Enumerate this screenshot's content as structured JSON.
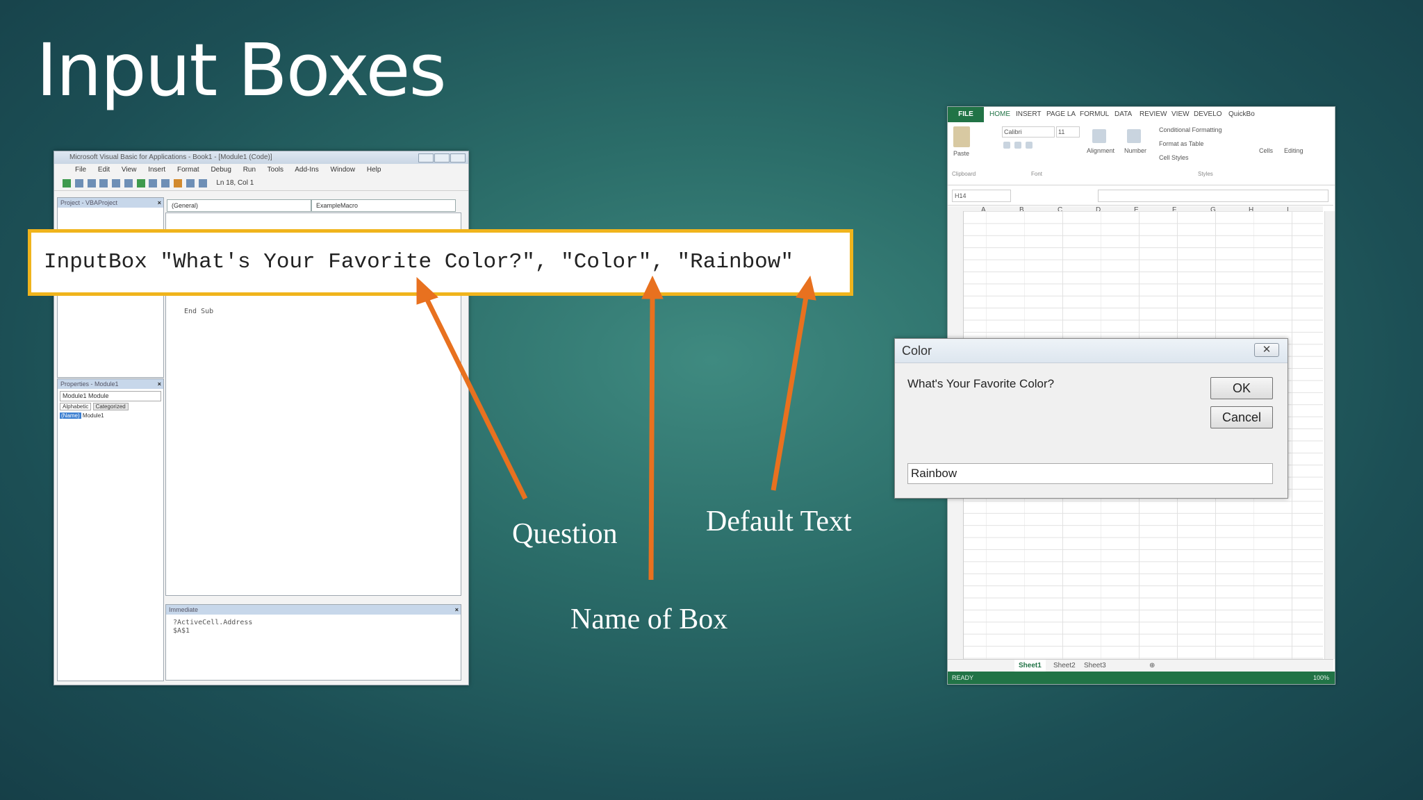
{
  "slide": {
    "title": "Input Boxes"
  },
  "vba": {
    "title": "Microsoft Visual Basic for Applications - Book1 - [Module1 (Code)]",
    "menu": [
      "File",
      "Edit",
      "View",
      "Insert",
      "Format",
      "Debug",
      "Run",
      "Tools",
      "Add-Ins",
      "Window",
      "Help"
    ],
    "position": "Ln 18, Col 1",
    "project_pane_title": "Project - VBAProject",
    "properties_pane_title": "Properties - Module1",
    "properties_object": "Module1 Module",
    "properties_tabs": [
      "Alphabetic",
      "Categorized"
    ],
    "properties_name_key": "(Name)",
    "properties_name_value": "Module1",
    "code_object": "(General)",
    "code_procedure": "ExampleMacro",
    "code_end": "End Sub",
    "immediate_title": "Immediate",
    "immediate_lines": [
      "?ActiveCell.Address",
      "$A$1"
    ]
  },
  "callout": {
    "code": "InputBox \"What's Your Favorite Color?\", \"Color\", \"Rainbow\""
  },
  "labels": {
    "question": "Question",
    "name_of_box": "Name of Box",
    "default_text": "Default Text"
  },
  "colors": {
    "arrow": "#e8711f",
    "callout_border": "#f0b41c",
    "excel_green": "#217346"
  },
  "excel": {
    "tabs": [
      "FILE",
      "HOME",
      "INSERT",
      "PAGE LA",
      "FORMUL",
      "DATA",
      "REVIEW",
      "VIEW",
      "DEVELO",
      "QuickBo"
    ],
    "font_name": "Calibri",
    "font_size": "11",
    "ribbon_groups": [
      "Clipboard",
      "Font",
      "Alignment",
      "Number",
      "Styles",
      "Cells",
      "Editing"
    ],
    "styles_items": [
      "Conditional Formatting",
      "Format as Table",
      "Cell Styles"
    ],
    "paste_label": "Paste",
    "name_box": "H14",
    "columns": [
      "A",
      "B",
      "C",
      "D",
      "E",
      "F",
      "G",
      "H",
      "I"
    ],
    "sheets": [
      "Sheet1",
      "Sheet2",
      "Sheet3"
    ],
    "status": "READY",
    "zoom": "100%"
  },
  "dialog": {
    "title": "Color",
    "prompt": "What's Your Favorite Color?",
    "ok_label": "OK",
    "cancel_label": "Cancel",
    "input_value": "Rainbow"
  }
}
